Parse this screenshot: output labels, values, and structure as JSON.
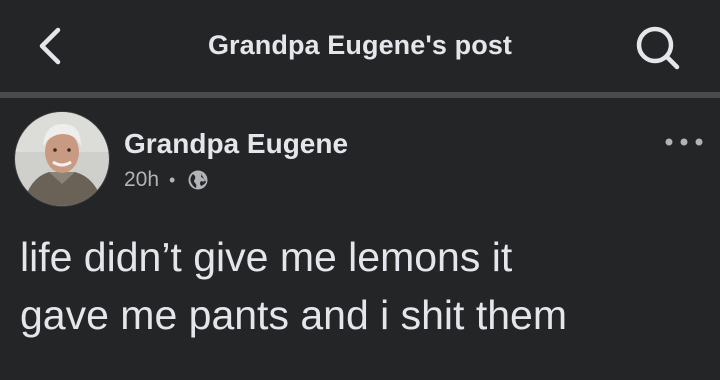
{
  "header": {
    "title": "Grandpa Eugene's post",
    "back_icon": "chevron-left-icon",
    "search_icon": "search-icon"
  },
  "post": {
    "author": "Grandpa Eugene",
    "time": "20h",
    "separator": "•",
    "privacy_icon": "globe-icon",
    "more_icon": "more-horizontal-icon",
    "text": "life didn’t give me lemons it\ngave me pants and i shit them"
  },
  "colors": {
    "background": "#242526",
    "divider": "#4a4b4d",
    "primary_text": "#e4e6eb",
    "secondary_text": "#b0b3b8"
  }
}
